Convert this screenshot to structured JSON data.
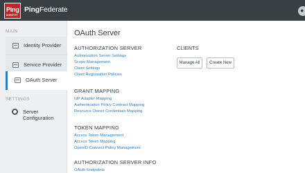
{
  "header": {
    "logo_text": "Ping",
    "logo_sub": "IDENTITY",
    "product_bold": "Ping",
    "product_rest": "Federate"
  },
  "sidebar": {
    "main_heading": "MAIN",
    "items": [
      {
        "label": "Identity Provider"
      },
      {
        "label": "Service Provider"
      },
      {
        "label": "OAuth Server"
      }
    ],
    "settings_heading": "SETTINGS",
    "config_label": "Server Configuration"
  },
  "main": {
    "title": "OAuth Server",
    "auth_server": {
      "title": "AUTHORIZATION SERVER",
      "links": [
        "Authorization Server Settings",
        "Scope Management",
        "Client Settings",
        "Client Registration Policies"
      ]
    },
    "clients": {
      "title": "CLIENTS",
      "manage_all": "Manage All",
      "create_new": "Create New"
    },
    "grant_mapping": {
      "title": "GRANT MAPPING",
      "links": [
        "IdP Adapter Mapping",
        "Authentication Policy Contract Mapping",
        "Resource Owner Credentials Mapping"
      ]
    },
    "token_mapping": {
      "title": "TOKEN MAPPING",
      "links": [
        "Access Token Management",
        "Access Token Mapping",
        "OpenID Connect Policy Management"
      ]
    },
    "server_info": {
      "title": "AUTHORIZATION SERVER INFO",
      "links": [
        "OAuth Endpoints"
      ]
    }
  },
  "colors": {
    "topbar": "#3a3f44",
    "brand_red": "#c5232c",
    "link": "#2a7ebf",
    "active_accent": "#2e7eb8"
  }
}
